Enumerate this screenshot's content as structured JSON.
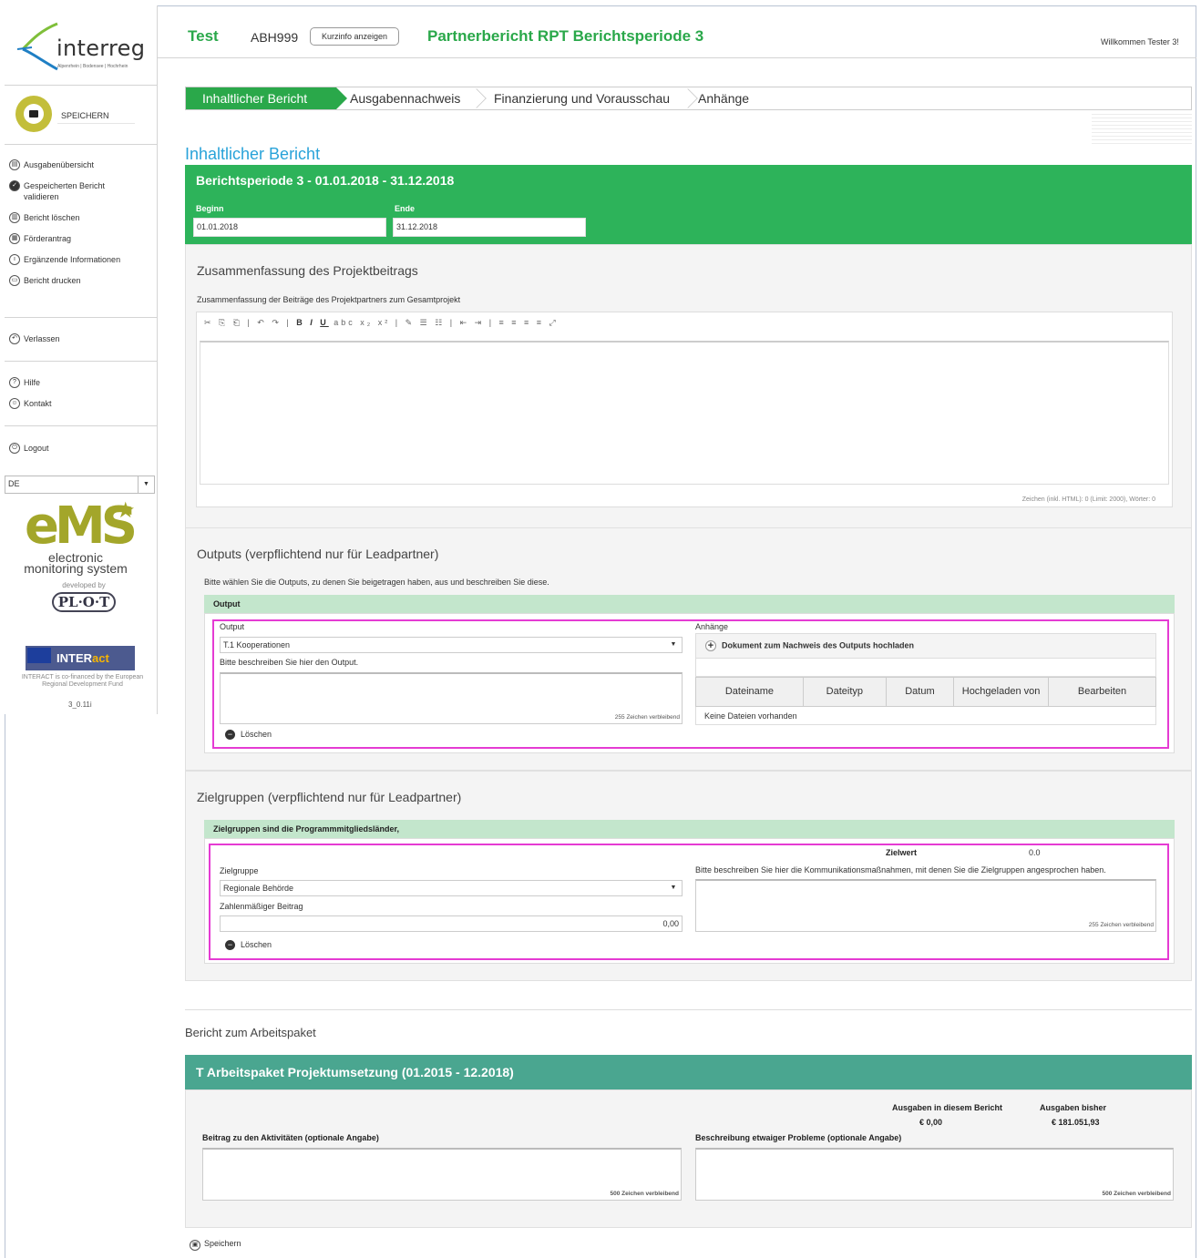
{
  "sidebar": {
    "logo": "interreg",
    "logo_sub": "Alpenrhein | Bodensee | Hochrhein",
    "save_label": "SPEICHERN",
    "nav_items": [
      {
        "label": "Ausgabenübersicht",
        "icon": "list-icon"
      },
      {
        "label": "Gespeicherten Bericht validieren",
        "icon": "check-icon"
      },
      {
        "label": "Bericht löschen",
        "icon": "trash-icon"
      },
      {
        "label": "Förderantrag",
        "icon": "bank-icon"
      },
      {
        "label": "Ergänzende Informationen",
        "icon": "info-icon"
      },
      {
        "label": "Bericht drucken",
        "icon": "print-icon"
      }
    ],
    "leave": "Verlassen",
    "help": "Hilfe",
    "contact": "Kontakt",
    "logout": "Logout",
    "language": "DE",
    "ems_word": "eMS",
    "ems_text": "electronic monitoring system",
    "developed_by": "developed by",
    "plot": "PL·O·T",
    "interact_pre": "INTER",
    "interact_post": "act",
    "cofinanced": "INTERACT is co-financed by the European Regional Development Fund",
    "version": "3_0.11i"
  },
  "header": {
    "project": "Test",
    "code": "ABH999",
    "kurzinfo": "Kurzinfo anzeigen",
    "report_title": "Partnerbericht RPT Berichtsperiode 3",
    "welcome": "Willkommen Tester 3!"
  },
  "tabs": [
    "Inhaltlicher Bericht",
    "Ausgabennachweis",
    "Finanzierung und Vorausschau",
    "Anhänge"
  ],
  "page_heading": "Inhaltlicher Bericht",
  "period": {
    "title": "Berichtsperiode 3 - 01.01.2018 - 31.12.2018",
    "begin_label": "Beginn",
    "begin_value": "01.01.2018",
    "end_label": "Ende",
    "end_value": "31.12.2018"
  },
  "summary": {
    "heading": "Zusammenfassung des Projektbeitrags",
    "label": "Zusammenfassung der Beiträge des Projektpartners zum Gesamtprojekt",
    "char_count": "Zeichen (inkl. HTML): 0 (Limit: 2000), Wörter: 0"
  },
  "outputs": {
    "heading": "Outputs (verpflichtend nur für Leadpartner)",
    "intro": "Bitte wählen Sie die Outputs, zu denen Sie beigetragen haben, aus und beschreiben Sie diese.",
    "table_head": "Output",
    "output_label": "Output",
    "output_value": "T.1 Kooperationen",
    "describe_label": "Bitte beschreiben Sie hier den Output.",
    "remaining": "255 Zeichen verbleibend",
    "delete": "Löschen",
    "attachments_label": "Anhänge",
    "upload": "Dokument zum Nachweis des Outputs hochladen",
    "columns": [
      "Dateiname",
      "Dateityp",
      "Datum",
      "Hochgeladen von",
      "Bearbeiten"
    ],
    "no_files": "Keine Dateien vorhanden"
  },
  "targets": {
    "heading": "Zielgruppen (verpflichtend nur für Leadpartner)",
    "table_head": "Zielgruppen sind die Programmmitgliedsländer,",
    "zielwert_label": "Zielwert",
    "zielwert_value": "0.0",
    "group_label": "Zielgruppe",
    "group_value": "Regionale Behörde",
    "describe_label": "Bitte beschreiben Sie hier die Kommunikationsmaßnahmen, mit denen Sie die Zielgruppen angesprochen haben.",
    "contribution_label": "Zahlenmäßiger Beitrag",
    "contribution_value": "0,00",
    "remaining": "255 Zeichen verbleibend",
    "delete": "Löschen"
  },
  "workpackage": {
    "heading": "Bericht zum Arbeitspaket",
    "band": "T Arbeitspaket Projektumsetzung (01.2015 - 12.2018)",
    "exp_report_label": "Ausgaben in diesem Bericht",
    "exp_report_value": "€ 0,00",
    "exp_total_label": "Ausgaben bisher",
    "exp_total_value": "€ 181.051,93",
    "activities_label": "Beitrag zu den Aktivitäten (optionale Angabe)",
    "problems_label": "Beschreibung etwaiger Probleme (optionale Angabe)",
    "remaining": "500 Zeichen verbleibend"
  },
  "footer_save": "Speichern",
  "colors": {
    "green": "#2db35a",
    "teal": "#4aa690",
    "heading_blue": "#29a3d9",
    "highlight": "#e53bd3",
    "ems": "#a3a62a"
  }
}
